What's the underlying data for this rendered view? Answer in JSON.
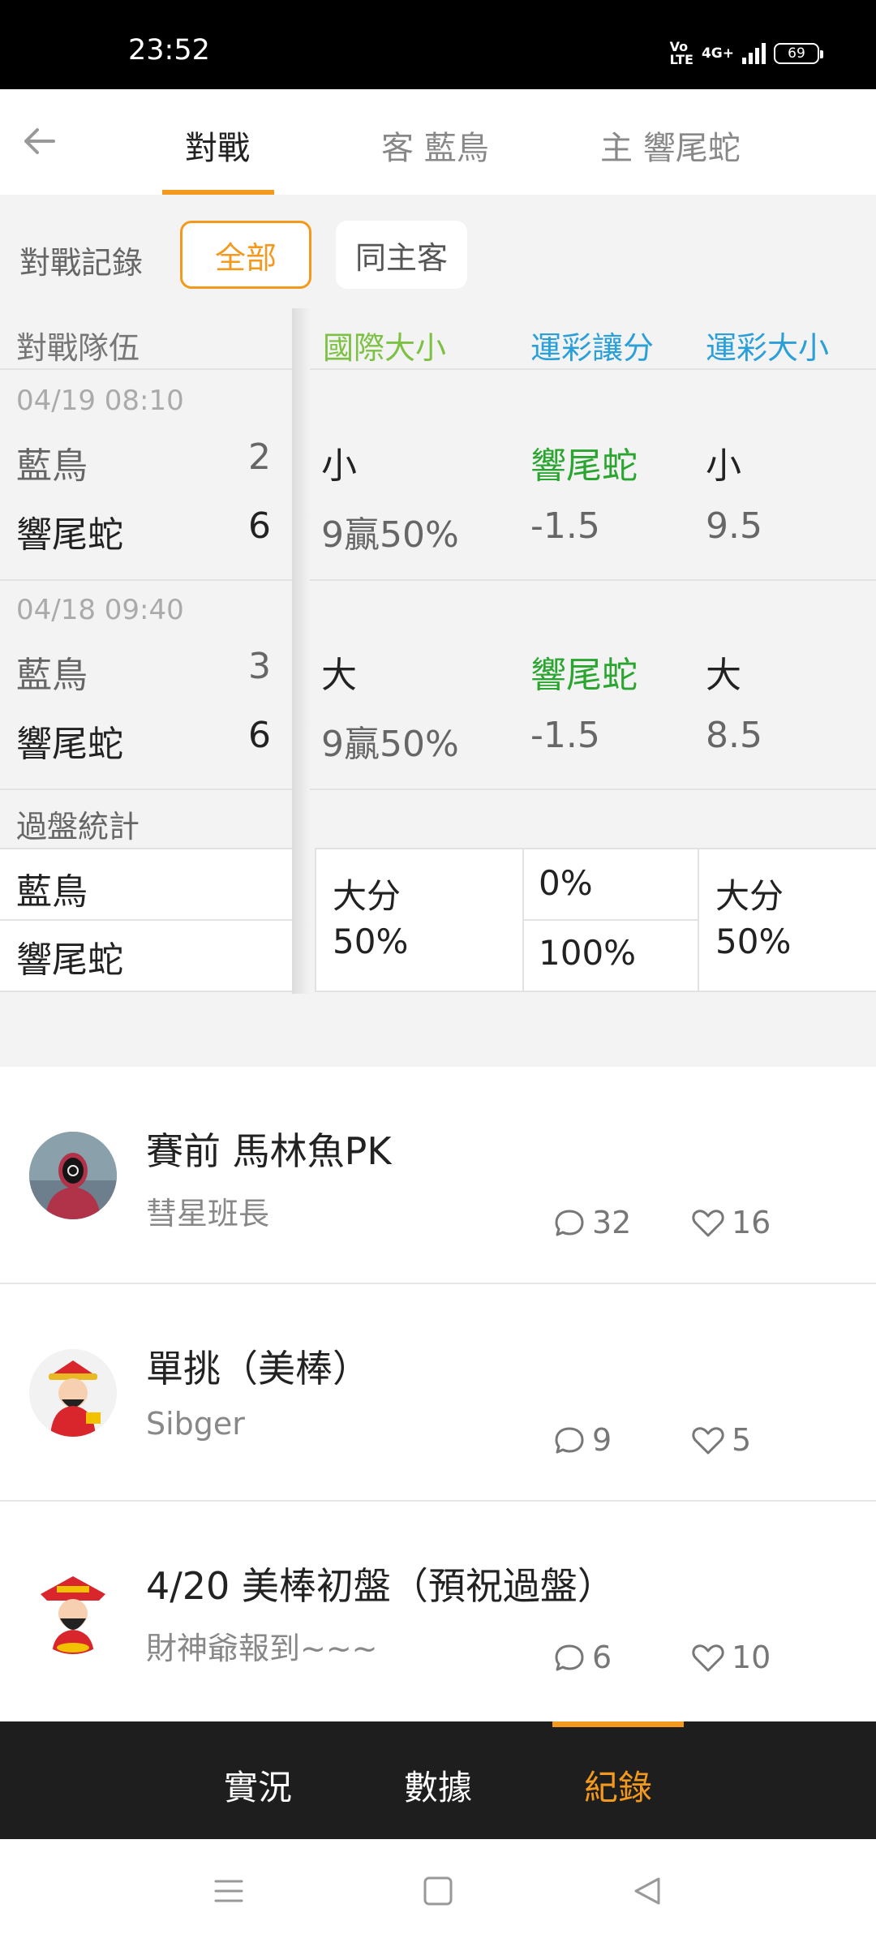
{
  "status": {
    "time": "23:52",
    "network_top": "Vo",
    "network_bottom": "LTE",
    "data": "4G+",
    "battery": "69"
  },
  "header": {
    "tabs": [
      {
        "label": "對戰",
        "active": true
      },
      {
        "label": "客 藍鳥",
        "active": false
      },
      {
        "label": "主 響尾蛇",
        "active": false
      }
    ]
  },
  "filter": {
    "label": "對戰記錄",
    "options": [
      "全部",
      "同主客"
    ],
    "selected": "全部"
  },
  "table": {
    "headers": [
      "對戰隊伍",
      "國際大小",
      "運彩讓分",
      "運彩大小"
    ],
    "header_colors": [
      "#777777",
      "#7cc142",
      "#2a9fd8",
      "#2a9fd8"
    ],
    "matches": [
      {
        "date": "04/19 08:10",
        "away": {
          "team": "藍鳥",
          "score": "2"
        },
        "home": {
          "team": "響尾蛇",
          "score": "6"
        },
        "intl_result": "小",
        "intl_detail": "9贏50%",
        "spread_result": "響尾蛇",
        "spread_value": "-1.5",
        "total_result": "小",
        "total_value": "9.5"
      },
      {
        "date": "04/18 09:40",
        "away": {
          "team": "藍鳥",
          "score": "3"
        },
        "home": {
          "team": "響尾蛇",
          "score": "6"
        },
        "intl_result": "大",
        "intl_detail": "9贏50%",
        "spread_result": "響尾蛇",
        "spread_value": "-1.5",
        "total_result": "大",
        "total_value": "8.5"
      }
    ]
  },
  "stats": {
    "title": "過盤統計",
    "teams": [
      "藍鳥",
      "響尾蛇"
    ],
    "intl": {
      "label": "大分",
      "pct": "50%"
    },
    "spread": {
      "away": "0%",
      "home": "100%"
    },
    "total": {
      "label": "大分",
      "pct": "50%"
    }
  },
  "posts": [
    {
      "title": "賽前 馬林魚PK",
      "author": "彗星班長",
      "comments": "32",
      "likes": "16",
      "avatar": "masked-figure-avatar"
    },
    {
      "title": "單挑（美棒）",
      "author": "Sibger",
      "comments": "9",
      "likes": "5",
      "avatar": "fortune-god-avatar"
    },
    {
      "title": "4/20 美棒初盤（預祝過盤）",
      "author": "財神爺報到~~~",
      "comments": "6",
      "likes": "10",
      "avatar": "fortune-god-avatar"
    }
  ],
  "bottom_nav": {
    "items": [
      "實況",
      "數據",
      "紀錄"
    ],
    "active": "紀錄"
  },
  "colors": {
    "accent": "#f39a1e",
    "green": "#2aa530",
    "intl_header": "#7cc142",
    "lottery_header": "#2a9fd8"
  }
}
